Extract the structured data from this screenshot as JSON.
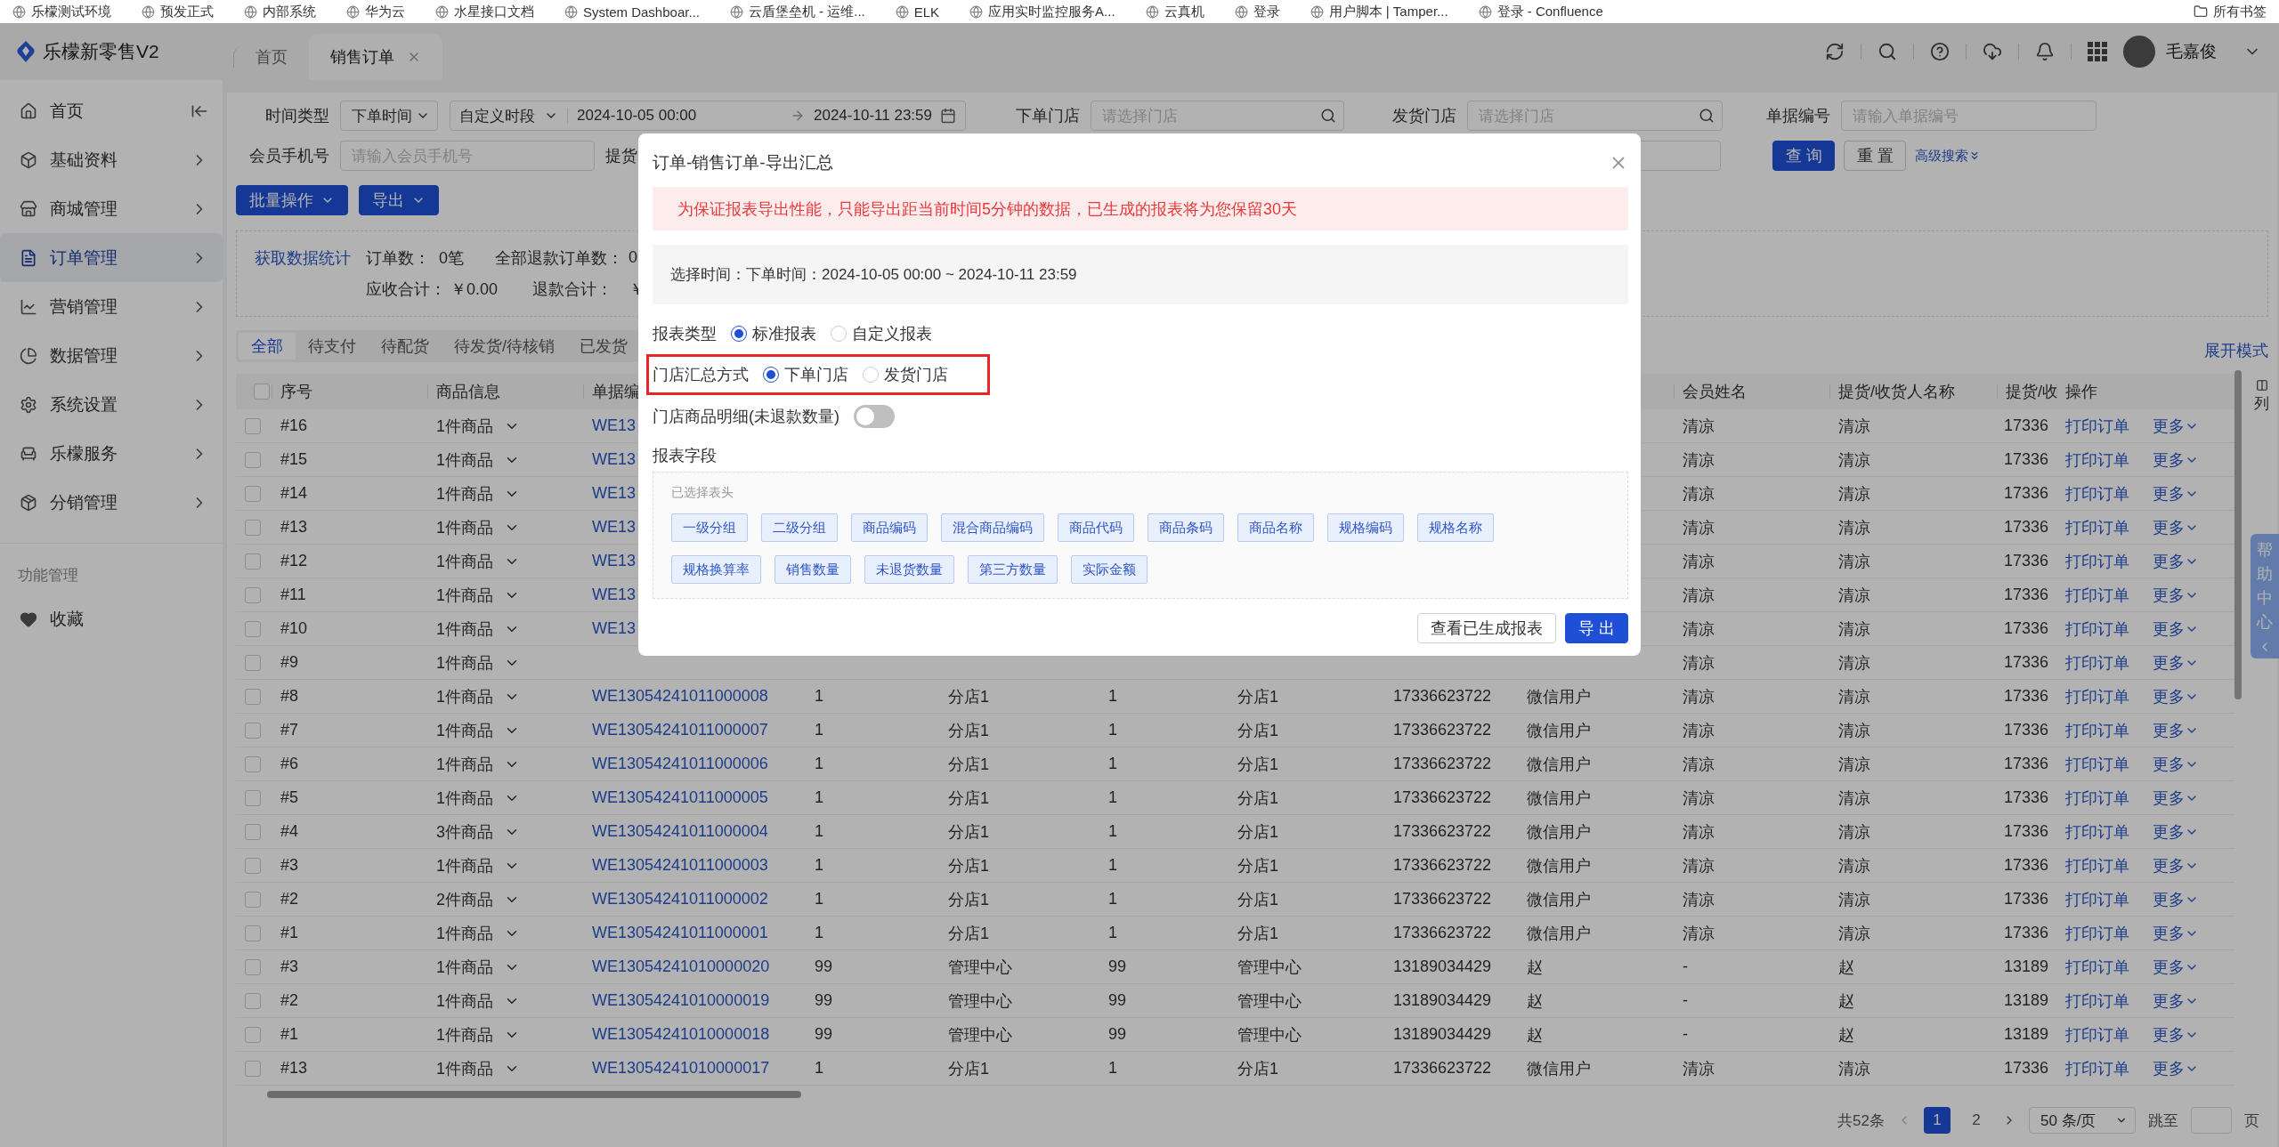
{
  "bookmarks": [
    {
      "label": "乐檬测试环境"
    },
    {
      "label": "预发正式"
    },
    {
      "label": "内部系统"
    },
    {
      "label": "华为云"
    },
    {
      "label": "水星接口文档"
    },
    {
      "label": "System Dashboar..."
    },
    {
      "label": "云盾堡垒机 - 运维..."
    },
    {
      "label": "ELK"
    },
    {
      "label": "应用实时监控服务A..."
    },
    {
      "label": "云真机"
    },
    {
      "label": "登录"
    },
    {
      "label": "用户脚本 | Tamper..."
    },
    {
      "label": "登录 - Confluence"
    }
  ],
  "all_bookmarks": "所有书签",
  "app": {
    "logo": "乐檬新零售V2",
    "tabs": [
      {
        "label": "首页",
        "selected": false,
        "closable": false
      },
      {
        "label": "销售订单",
        "selected": true,
        "closable": true
      }
    ],
    "user": "毛嘉俊"
  },
  "sidebar": {
    "items": [
      {
        "label": "首页",
        "kind": "top",
        "selected": false
      },
      {
        "label": "基础资料",
        "kind": "menu",
        "selected": false
      },
      {
        "label": "商城管理",
        "kind": "menu",
        "selected": false
      },
      {
        "label": "订单管理",
        "kind": "menu",
        "selected": true
      },
      {
        "label": "营销管理",
        "kind": "menu",
        "selected": false
      },
      {
        "label": "数据管理",
        "kind": "menu",
        "selected": false
      },
      {
        "label": "系统设置",
        "kind": "menu",
        "selected": false
      },
      {
        "label": "乐檬服务",
        "kind": "menu",
        "selected": false
      },
      {
        "label": "分销管理",
        "kind": "menu",
        "selected": false
      }
    ],
    "group_label": "功能管理",
    "favorites": "收藏"
  },
  "filters": {
    "time_type": {
      "label": "时间类型",
      "value": "下单时间"
    },
    "period": {
      "value": "自定义时段",
      "start": "2024-10-05 00:00",
      "end": "2024-10-11 23:59"
    },
    "order_store": {
      "label": "下单门店",
      "placeholder": "请选择门店"
    },
    "ship_store": {
      "label": "发货门店",
      "placeholder": "请选择门店"
    },
    "doc_no": {
      "label": "单据编号",
      "placeholder": "请输入单据编号"
    },
    "member_phone": {
      "label": "会员手机号",
      "placeholder": "请输入会员手机号"
    },
    "pickup": {
      "label": "提货"
    },
    "query": "查 询",
    "reset": "重 置",
    "advanced": "高级搜索"
  },
  "actions": [
    "批量操作",
    "导出"
  ],
  "stats": {
    "fetch": "获取数据统计",
    "items": [
      {
        "label": "订单数：",
        "value": "0笔"
      },
      {
        "label": "全部退款订单数：",
        "value": "0"
      },
      {
        "label": "应收合计：",
        "value": "￥0.00"
      },
      {
        "label": "退款合计：",
        "value": "￥"
      }
    ]
  },
  "status_tabs": [
    {
      "label": "全部",
      "selected": true
    },
    {
      "label": "待支付",
      "selected": false
    },
    {
      "label": "待配货",
      "selected": false
    },
    {
      "label": "待发货/待核销",
      "selected": false
    },
    {
      "label": "已发货",
      "selected": false
    }
  ],
  "expand_mode": "展开模式",
  "table": {
    "header_checked": false,
    "columns": [
      "序号",
      "商品信息",
      "单据编",
      "",
      "",
      "",
      "",
      "",
      "",
      "会员姓名",
      "提货/收货人名称",
      "提货/收",
      "操作"
    ],
    "rows": [
      {
        "checked": false,
        "cells": [
          "#16",
          "1件商品",
          "WE13",
          "",
          "",
          "",
          "",
          "",
          "",
          "清凉",
          "清凉",
          "17336"
        ],
        "print": "打印订单",
        "more": "更多"
      },
      {
        "checked": false,
        "cells": [
          "#15",
          "1件商品",
          "WE13",
          "",
          "",
          "",
          "",
          "",
          "",
          "清凉",
          "清凉",
          "17336"
        ],
        "print": "打印订单",
        "more": "更多"
      },
      {
        "checked": false,
        "cells": [
          "#14",
          "1件商品",
          "WE13",
          "",
          "",
          "",
          "",
          "",
          "",
          "清凉",
          "清凉",
          "17336"
        ],
        "print": "打印订单",
        "more": "更多"
      },
      {
        "checked": false,
        "cells": [
          "#13",
          "1件商品",
          "WE13",
          "",
          "",
          "",
          "",
          "",
          "",
          "清凉",
          "清凉",
          "17336"
        ],
        "print": "打印订单",
        "more": "更多"
      },
      {
        "checked": false,
        "cells": [
          "#12",
          "1件商品",
          "WE13",
          "",
          "",
          "",
          "",
          "",
          "",
          "清凉",
          "清凉",
          "17336"
        ],
        "print": "打印订单",
        "more": "更多"
      },
      {
        "checked": false,
        "cells": [
          "#11",
          "1件商品",
          "WE13",
          "",
          "",
          "",
          "",
          "",
          "",
          "清凉",
          "清凉",
          "17336"
        ],
        "print": "打印订单",
        "more": "更多"
      },
      {
        "checked": false,
        "cells": [
          "#10",
          "1件商品",
          "WE13",
          "",
          "",
          "",
          "",
          "",
          "",
          "清凉",
          "清凉",
          "17336"
        ],
        "print": "打印订单",
        "more": "更多"
      },
      {
        "checked": false,
        "cells": [
          "#9",
          "1件商品",
          "",
          "",
          "",
          "",
          "",
          "",
          "",
          "清凉",
          "清凉",
          "17336"
        ],
        "print": "打印订单",
        "more": "更多"
      },
      {
        "checked": false,
        "cells": [
          "#8",
          "1件商品",
          "WE13054241011000008",
          "1",
          "分店1",
          "1",
          "分店1",
          "17336623722",
          "微信用户",
          "清凉",
          "清凉",
          "17336"
        ],
        "print": "打印订单",
        "more": "更多"
      },
      {
        "checked": false,
        "cells": [
          "#7",
          "1件商品",
          "WE13054241011000007",
          "1",
          "分店1",
          "1",
          "分店1",
          "17336623722",
          "微信用户",
          "清凉",
          "清凉",
          "17336"
        ],
        "print": "打印订单",
        "more": "更多"
      },
      {
        "checked": false,
        "cells": [
          "#6",
          "1件商品",
          "WE13054241011000006",
          "1",
          "分店1",
          "1",
          "分店1",
          "17336623722",
          "微信用户",
          "清凉",
          "清凉",
          "17336"
        ],
        "print": "打印订单",
        "more": "更多"
      },
      {
        "checked": false,
        "cells": [
          "#5",
          "1件商品",
          "WE13054241011000005",
          "1",
          "分店1",
          "1",
          "分店1",
          "17336623722",
          "微信用户",
          "清凉",
          "清凉",
          "17336"
        ],
        "print": "打印订单",
        "more": "更多"
      },
      {
        "checked": false,
        "cells": [
          "#4",
          "3件商品",
          "WE13054241011000004",
          "1",
          "分店1",
          "1",
          "分店1",
          "17336623722",
          "微信用户",
          "清凉",
          "清凉",
          "17336"
        ],
        "print": "打印订单",
        "more": "更多"
      },
      {
        "checked": false,
        "cells": [
          "#3",
          "1件商品",
          "WE13054241011000003",
          "1",
          "分店1",
          "1",
          "分店1",
          "17336623722",
          "微信用户",
          "清凉",
          "清凉",
          "17336"
        ],
        "print": "打印订单",
        "more": "更多"
      },
      {
        "checked": false,
        "cells": [
          "#2",
          "2件商品",
          "WE13054241011000002",
          "1",
          "分店1",
          "1",
          "分店1",
          "17336623722",
          "微信用户",
          "清凉",
          "清凉",
          "17336"
        ],
        "print": "打印订单",
        "more": "更多"
      },
      {
        "checked": false,
        "cells": [
          "#1",
          "1件商品",
          "WE13054241011000001",
          "1",
          "分店1",
          "1",
          "分店1",
          "17336623722",
          "微信用户",
          "清凉",
          "清凉",
          "17336"
        ],
        "print": "打印订单",
        "more": "更多"
      },
      {
        "checked": false,
        "cells": [
          "#3",
          "1件商品",
          "WE13054241010000020",
          "99",
          "管理中心",
          "99",
          "管理中心",
          "13189034429",
          "赵",
          "-",
          "赵",
          "13189"
        ],
        "print": "打印订单",
        "more": "更多"
      },
      {
        "checked": false,
        "cells": [
          "#2",
          "1件商品",
          "WE13054241010000019",
          "99",
          "管理中心",
          "99",
          "管理中心",
          "13189034429",
          "赵",
          "-",
          "赵",
          "13189"
        ],
        "print": "打印订单",
        "more": "更多"
      },
      {
        "checked": false,
        "cells": [
          "#1",
          "1件商品",
          "WE13054241010000018",
          "99",
          "管理中心",
          "99",
          "管理中心",
          "13189034429",
          "赵",
          "-",
          "赵",
          "13189"
        ],
        "print": "打印订单",
        "more": "更多"
      },
      {
        "checked": false,
        "cells": [
          "#13",
          "1件商品",
          "WE13054241010000017",
          "1",
          "分店1",
          "1",
          "分店1",
          "17336623722",
          "微信用户",
          "清凉",
          "清凉",
          "17336"
        ],
        "print": "打印订单",
        "more": "更多"
      }
    ]
  },
  "column_settings": "列",
  "pagination": {
    "total": "共52条",
    "pages": [
      {
        "label": "1",
        "selected": true
      },
      {
        "label": "2",
        "selected": false
      }
    ],
    "page_size": "50 条/页",
    "jump_label": "跳至",
    "page_suffix": "页"
  },
  "help": "帮助中心",
  "dialog": {
    "title": "订单-销售订单-导出汇总",
    "notice": "为保证报表导出性能，只能导出距当前时间5分钟的数据，已生成的报表将为您保留30天",
    "selection": "选择时间：下单时间：2024-10-05 00:00 ~ 2024-10-11 23:59",
    "options": [
      {
        "label": "报表类型",
        "kind": "radio",
        "highlighted": false,
        "choices": [
          {
            "label": "标准报表",
            "selected": true
          },
          {
            "label": "自定义报表",
            "selected": false
          }
        ]
      },
      {
        "label": "门店汇总方式",
        "kind": "radio",
        "highlighted": true,
        "choices": [
          {
            "label": "下单门店",
            "selected": true
          },
          {
            "label": "发货门店",
            "selected": false
          }
        ]
      },
      {
        "label": "门店商品明细(未退款数量)",
        "kind": "switch",
        "highlighted": false,
        "on": false
      }
    ],
    "fields": {
      "label": "报表字段",
      "hint": "已选择表头",
      "tags": [
        "一级分组",
        "二级分组",
        "商品编码",
        "混合商品编码",
        "商品代码",
        "商品条码",
        "商品名称",
        "规格编码",
        "规格名称",
        "规格换算率",
        "销售数量",
        "未退货数量",
        "第三方数量",
        "实际金额"
      ]
    },
    "buttons": [
      {
        "label": "查看已生成报表",
        "kind": "default"
      },
      {
        "label": "导 出",
        "kind": "primary"
      }
    ]
  }
}
